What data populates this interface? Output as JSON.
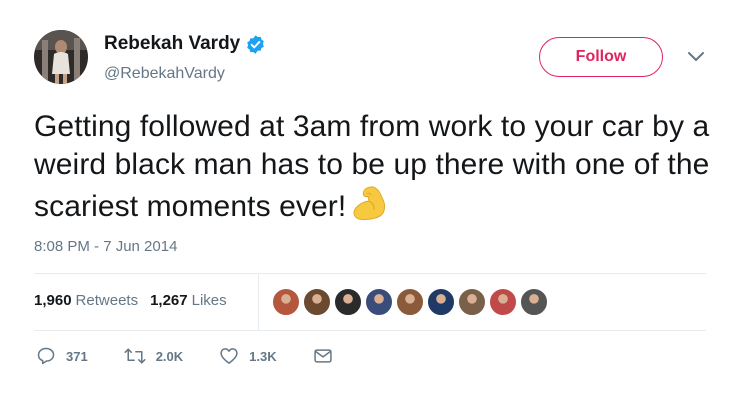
{
  "author": {
    "name": "Rebekah Vardy",
    "handle": "@RebekahVardy",
    "avatar_icon": "profile-photo",
    "verified_icon": "verified-badge-icon"
  },
  "follow_button": {
    "label": "Follow",
    "color": "#e0245e"
  },
  "tweet": {
    "text": "Getting followed at 3am from work to your car by a weird black man has to be up there with one of the scariest moments ever!",
    "emoji_icon": "flexed-biceps-emoji",
    "timestamp": "8:08 PM - 7 Jun 2014"
  },
  "stats": {
    "retweets_count": "1,960",
    "retweets_label": "Retweets",
    "likes_count": "1,267",
    "likes_label": "Likes"
  },
  "liker_avatars": [
    {
      "color": "#b5563f"
    },
    {
      "color": "#6b4a2f"
    },
    {
      "color": "#2b2b2b"
    },
    {
      "color": "#3a4d7a"
    },
    {
      "color": "#8a5a3a"
    },
    {
      "color": "#1f3a66"
    },
    {
      "color": "#7a6048"
    },
    {
      "color": "#c04a4a"
    },
    {
      "color": "#555555"
    }
  ],
  "actions": {
    "reply_count": "371",
    "retweet_count": "2.0K",
    "like_count": "1.3K"
  },
  "colors": {
    "text": "#14171a",
    "secondary": "#657786",
    "divider": "#e6ecf0",
    "verified": "#1da1f2"
  }
}
